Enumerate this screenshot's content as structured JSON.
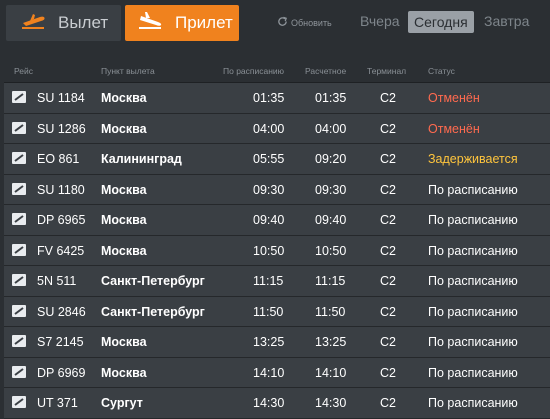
{
  "header": {
    "departures_label": "Вылет",
    "arrivals_label": "Прилет",
    "refresh_label": "Обновить",
    "days": [
      "Вчера",
      "Сегодня",
      "Завтра"
    ]
  },
  "columns": [
    "Рейс",
    "Пункт вылета",
    "По расписанию",
    "Расчетное",
    "Терминал",
    "Статус"
  ],
  "colors": {
    "accent": "#f0821e",
    "cancelled": "#ff6a4f",
    "delayed": "#ffc53d"
  },
  "flights": [
    {
      "icon": "airline-logo-icon",
      "flight": "SU 1184",
      "city": "Москва",
      "scheduled": "01:35",
      "expected": "01:35",
      "terminal": "C2",
      "status": "Отменён",
      "status_type": "cancel"
    },
    {
      "icon": "airline-logo-icon",
      "flight": "SU 1286",
      "city": "Москва",
      "scheduled": "04:00",
      "expected": "04:00",
      "terminal": "C2",
      "status": "Отменён",
      "status_type": "cancel"
    },
    {
      "icon": "airline-logo-icon",
      "flight": "EO 861",
      "city": "Калининград",
      "scheduled": "05:55",
      "expected": "09:20",
      "terminal": "C2",
      "status": "Задерживается",
      "status_type": "delay"
    },
    {
      "icon": "airline-logo-icon",
      "flight": "SU 1180",
      "city": "Москва",
      "scheduled": "09:30",
      "expected": "09:30",
      "terminal": "C2",
      "status": "По расписанию",
      "status_type": "ok"
    },
    {
      "icon": "airline-logo-icon",
      "flight": "DP 6965",
      "city": "Москва",
      "scheduled": "09:40",
      "expected": "09:40",
      "terminal": "C2",
      "status": "По расписанию",
      "status_type": "ok"
    },
    {
      "icon": "airline-logo-icon",
      "flight": "FV 6425",
      "city": "Москва",
      "scheduled": "10:50",
      "expected": "10:50",
      "terminal": "C2",
      "status": "По расписанию",
      "status_type": "ok"
    },
    {
      "icon": "airline-logo-icon",
      "flight": "5N 511",
      "city": "Санкт-Петербург",
      "scheduled": "11:15",
      "expected": "11:15",
      "terminal": "C2",
      "status": "По расписанию",
      "status_type": "ok"
    },
    {
      "icon": "airline-logo-icon",
      "flight": "SU 2846",
      "city": "Санкт-Петербург",
      "scheduled": "11:50",
      "expected": "11:50",
      "terminal": "C2",
      "status": "По расписанию",
      "status_type": "ok"
    },
    {
      "icon": "airline-logo-icon",
      "flight": "S7 2145",
      "city": "Москва",
      "scheduled": "13:25",
      "expected": "13:25",
      "terminal": "C2",
      "status": "По расписанию",
      "status_type": "ok"
    },
    {
      "icon": "airline-logo-icon",
      "flight": "DP 6969",
      "city": "Москва",
      "scheduled": "14:10",
      "expected": "14:10",
      "terminal": "C2",
      "status": "По расписанию",
      "status_type": "ok"
    },
    {
      "icon": "airline-logo-icon",
      "flight": "UT 371",
      "city": "Сургут",
      "scheduled": "14:30",
      "expected": "14:30",
      "terminal": "C2",
      "status": "По расписанию",
      "status_type": "ok"
    }
  ]
}
